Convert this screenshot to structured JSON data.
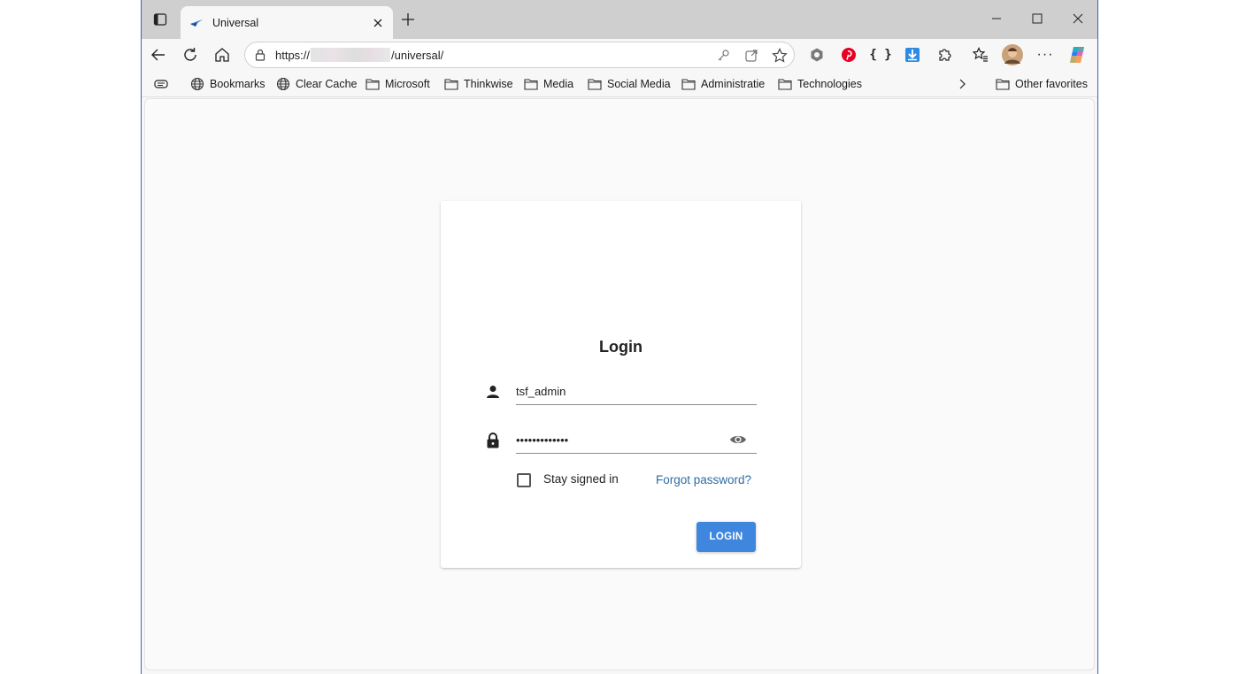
{
  "browser": {
    "tab": {
      "title": "Universal",
      "favicon": "universal-logo-icon"
    },
    "address": {
      "url_prefix": "https://",
      "url_path": "/universal/"
    },
    "favorites": [
      {
        "label": "Bookmarks",
        "icon": "globe-icon"
      },
      {
        "label": "Clear Cache",
        "icon": "globe-icon"
      },
      {
        "label": "Microsoft",
        "icon": "folder-icon"
      },
      {
        "label": "Thinkwise",
        "icon": "folder-icon"
      },
      {
        "label": "Media",
        "icon": "folder-icon"
      },
      {
        "label": "Social Media",
        "icon": "folder-icon"
      },
      {
        "label": "Administratie",
        "icon": "folder-icon"
      },
      {
        "label": "Technologies",
        "icon": "folder-icon"
      }
    ],
    "other_favorites": "Other favorites",
    "accent": "#2b6cb0"
  },
  "login": {
    "title": "Login",
    "username_value": "tsf_admin",
    "password_value": "•••••••••••••",
    "stay_signed_in": {
      "label": "Stay signed in",
      "checked": false
    },
    "forgot_password": "Forgot password?",
    "button_label": "LOGIN",
    "button_color": "#3f86df",
    "link_color": "#2e6ca4"
  }
}
